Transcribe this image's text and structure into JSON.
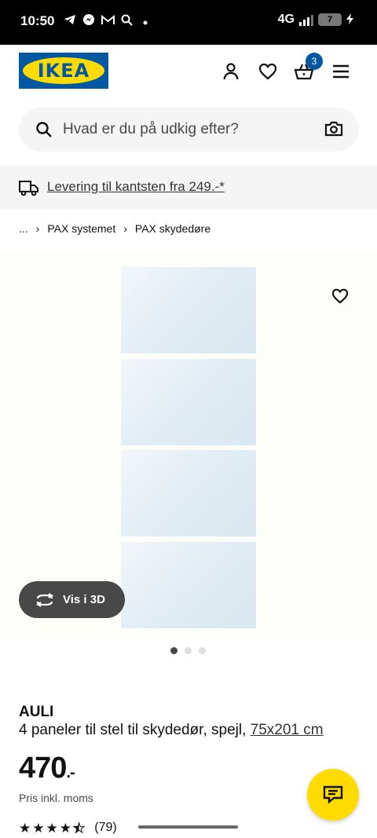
{
  "status_bar": {
    "time": "10:50",
    "network": "4G",
    "battery": "7"
  },
  "header": {
    "logo_text": "IKEA",
    "cart_count": "3"
  },
  "search": {
    "placeholder": "Hvad er du på udkig efter?"
  },
  "delivery": {
    "text": "Levering til kantsten fra 249.-*"
  },
  "breadcrumb": {
    "ellipsis": "...",
    "items": [
      "PAX systemet",
      "PAX skydedøre"
    ]
  },
  "gallery": {
    "view_3d_label": "Vis i 3D",
    "dot_count": 3,
    "active_dot": 0
  },
  "product": {
    "name": "AULI",
    "description": "4 paneler til stel til skydedør, spejl,",
    "dimensions": "75x201 cm",
    "price": "470",
    "price_suffix": ".-",
    "vat_note": "Pris inkl. moms",
    "rating": 4.5,
    "rating_count": "(79)"
  },
  "colors": {
    "ikea_blue": "#0058a3",
    "ikea_yellow": "#ffdb00"
  }
}
